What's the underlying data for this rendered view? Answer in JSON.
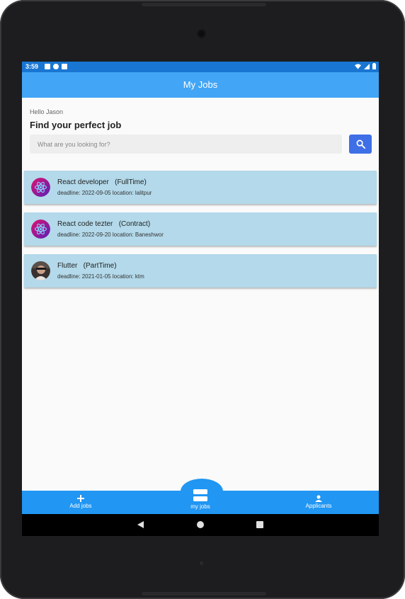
{
  "status_bar": {
    "time": "3:59"
  },
  "app_bar": {
    "title": "My Jobs"
  },
  "greeting": "Hello Jason",
  "headline": "Find your perfect job",
  "search": {
    "placeholder": "What are you looking for?",
    "value": ""
  },
  "jobs": [
    {
      "title": "React developer   (FullTime)",
      "meta": "deadline: 2022-09-05 location: lalitpur",
      "icon": "react-logo-icon"
    },
    {
      "title": "React code tezter   (Contract)",
      "meta": "deadline: 2022-09-20 location: Baneshwor",
      "icon": "react-logo-icon"
    },
    {
      "title": "Flutter   (PartTime)",
      "meta": "deadline: 2021-01-05 location: ktm",
      "icon": "person-photo-avatar"
    }
  ],
  "bottom_nav": [
    {
      "label": "Add jobs",
      "icon": "plus-icon"
    },
    {
      "label": "my jobs",
      "icon": "list-icon",
      "selected": true
    },
    {
      "label": "Applicants",
      "icon": "person-icon"
    }
  ],
  "colors": {
    "status_bar": "#1976d2",
    "app_bar": "#42a5f5",
    "card": "#b3d9ea",
    "search_button": "#3f6fe6",
    "bottom_nav": "#2196f3"
  }
}
